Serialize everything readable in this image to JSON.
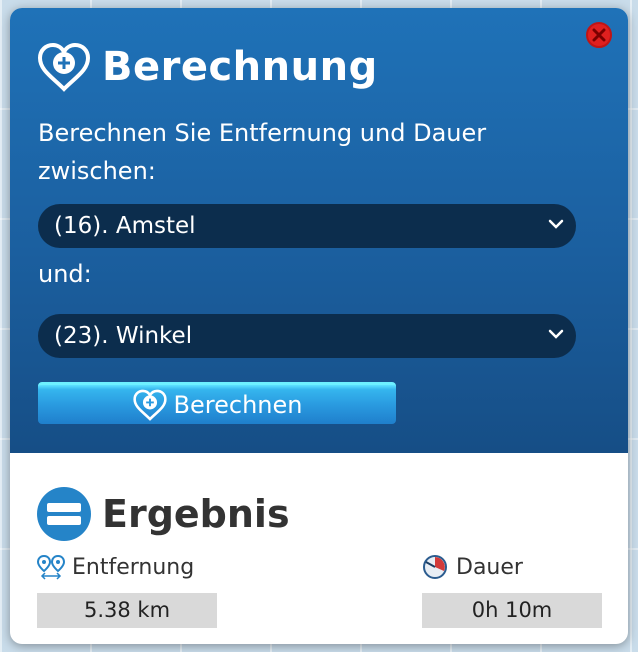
{
  "dialog": {
    "title": "Berechnung",
    "description": "Berechnen Sie Entfernung und Dauer zwischen:",
    "from_select": {
      "value": "(16). Amstel"
    },
    "connector": "und:",
    "to_select": {
      "value": "(23). Winkel"
    },
    "calculate_button": "Berechnen",
    "close_icon": "close-icon"
  },
  "result": {
    "title": "Ergebnis",
    "distance": {
      "label": "Entfernung",
      "value": "5.38 km",
      "icon": "route-pins-icon"
    },
    "duration": {
      "label": "Dauer",
      "value": "0h 10m",
      "icon": "clock-icon"
    }
  },
  "colors": {
    "header_blue": "#1f72b8",
    "select_bg": "#0c2d4d",
    "button_blue": "#2a9be0",
    "close_red": "#e0201f",
    "value_box": "#d9d9d9"
  }
}
